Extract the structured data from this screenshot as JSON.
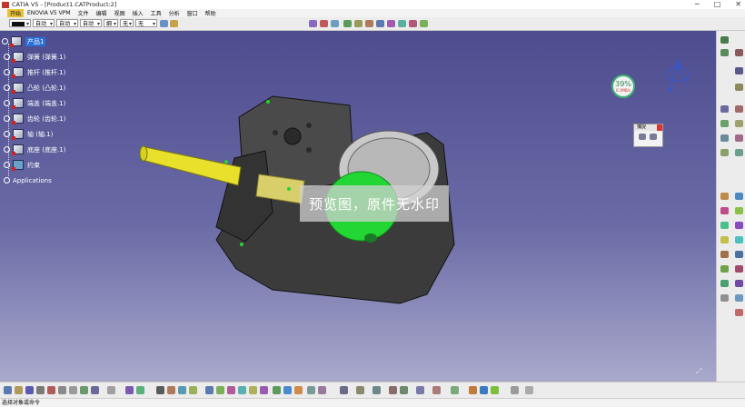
{
  "window": {
    "title": "CATIA V5 - [Product1.CATProduct:2]",
    "controls": [
      "─",
      "□",
      "✕"
    ]
  },
  "menu": {
    "items": [
      "开始",
      "ENOVIA V5 VPM",
      "文件",
      "编辑",
      "视图",
      "插入",
      "工具",
      "分析",
      "窗口",
      "帮助"
    ]
  },
  "toolbar": {
    "color_value": "",
    "line_type_value": "自动",
    "line_weight_value": "自动",
    "layer_value": "自动",
    "line_style_value": "细",
    "point_value": "无",
    "filter_value": "无"
  },
  "tree": {
    "root": "产品1",
    "nodes": [
      "弹簧 (弹簧.1)",
      "推杆 (推杆.1)",
      "凸轮 (凸轮.1)",
      "端盖 (端盖.1)",
      "齿轮 (齿轮.1)",
      "轴 (轴.1)",
      "底座 (底座.1)"
    ],
    "constraints": "约束",
    "applications": "Applications"
  },
  "performance": {
    "value": "39%",
    "sub": "0.1MB/s"
  },
  "capture_panel": {
    "title": "捕捉"
  },
  "watermark": "预览图，原件无水印",
  "status": {
    "text": "选择对象或命令"
  },
  "colors": {
    "gear": "#c9c9c9",
    "cam": "#22d633",
    "shaft": "#e8e02a",
    "housing": "#3d3d3d",
    "tree_selection": "#2a6fd6"
  }
}
